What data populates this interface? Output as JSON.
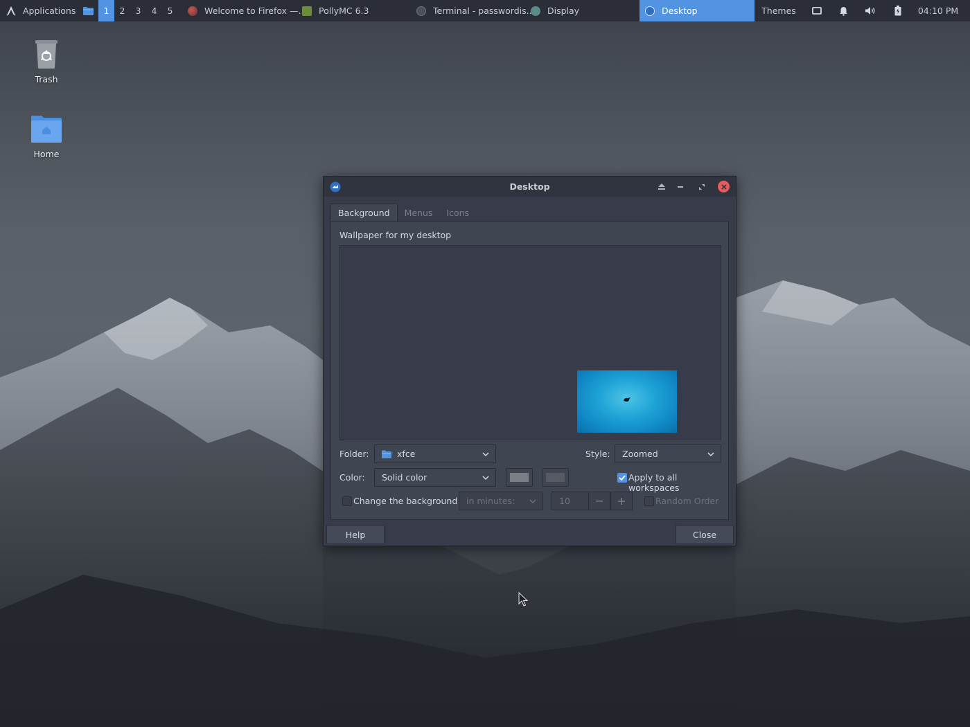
{
  "panel": {
    "app_menu_label": "Applications",
    "workspaces": [
      "1",
      "2",
      "3",
      "4",
      "5"
    ],
    "active_workspace": "1",
    "tasks": [
      {
        "label": "Welcome to Firefox —...",
        "icon": "firefox-icon"
      },
      {
        "label": "PollyMC 6.3",
        "icon": "pollymc-icon"
      },
      {
        "label": "Terminal - passwordis...",
        "icon": "terminal-icon"
      },
      {
        "label": "Display",
        "icon": "display-icon"
      },
      {
        "label": "Desktop",
        "icon": "desktop-settings-icon",
        "active": true
      }
    ],
    "themes_label": "Themes",
    "clock": "04:10 PM"
  },
  "desktop_icons": {
    "trash": "Trash",
    "home": "Home"
  },
  "dialog": {
    "title": "Desktop",
    "tabs": [
      "Background",
      "Menus",
      "Icons"
    ],
    "active_tab": "Background",
    "wallpaper_label": "Wallpaper for my desktop",
    "folder_label": "Folder:",
    "folder_value": "xfce",
    "style_label": "Style:",
    "style_value": "Zoomed",
    "color_label": "Color:",
    "color_value": "Solid color",
    "apply_all_label": "Apply to all workspaces",
    "apply_all_checked": true,
    "change_bg_label": "Change the background",
    "change_bg_checked": false,
    "interval_placeholder": "in minutes:",
    "interval_value": "10",
    "random_order_label": "Random Order",
    "help_label": "Help",
    "close_label": "Close"
  },
  "colors": {
    "accent": "#5294e2",
    "panel_bg": "#2b2e37",
    "dialog_bg": "#383c4a",
    "close_button": "#e65b5b",
    "swatch_primary": "#7b7e84",
    "swatch_secondary": "#5f6269"
  }
}
